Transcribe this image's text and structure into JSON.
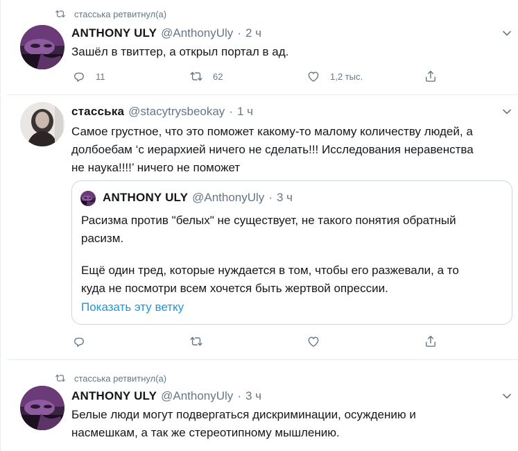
{
  "tweets": [
    {
      "retweet_label": "стасська ретвитнул(а)",
      "author_name": "ANTHONY ULY",
      "author_handle": "@AnthonyUly",
      "separator": "·",
      "time": "2 ч",
      "lines": [
        "Зашёл в твиттер, а открыл портал в ад."
      ],
      "replies": "11",
      "retweets": "62",
      "likes": "1,2 тыс."
    },
    {
      "author_name": "стасська",
      "author_handle": "@stacytrysbeokay",
      "separator": "·",
      "time": "1 ч",
      "lines": [
        "Самое грустное, что это поможет какому-то малому количеству людей, а",
        "долбоебам ‘с иерархией ничего не сделать!!! Исследования неравенства",
        "не наука!!!!’ ничего не поможет"
      ],
      "quote": {
        "author_name": "ANTHONY ULY",
        "author_handle": "@AnthonyUly",
        "separator": "·",
        "time": "3 ч",
        "lines": [
          "Расизма против \"белых\" не существует, не такого понятия обратный",
          "расизм.",
          "Ещё один тред, которые нуждается в том, чтобы его разжевали, а то",
          "куда не посмотри всем хочется быть жертвой опрессии."
        ],
        "link": "Показать эту ветку"
      }
    },
    {
      "retweet_label": "стасська ретвитнул(а)",
      "author_name": "ANTHONY ULY",
      "author_handle": "@AnthonyUly",
      "separator": "·",
      "time": "3 ч",
      "lines": [
        "Белые люди могут подвергаться дискриминации, осуждению и",
        "насмешкам, а так же стереотипному мышлению."
      ]
    }
  ],
  "colors": {
    "text": "#14171a",
    "secondary": "#657786",
    "link": "#1b95e0",
    "border": "#e6ecf0"
  },
  "icons": [
    "retweet-icon",
    "reply-icon",
    "like-icon",
    "share-icon",
    "caret-down-icon"
  ]
}
